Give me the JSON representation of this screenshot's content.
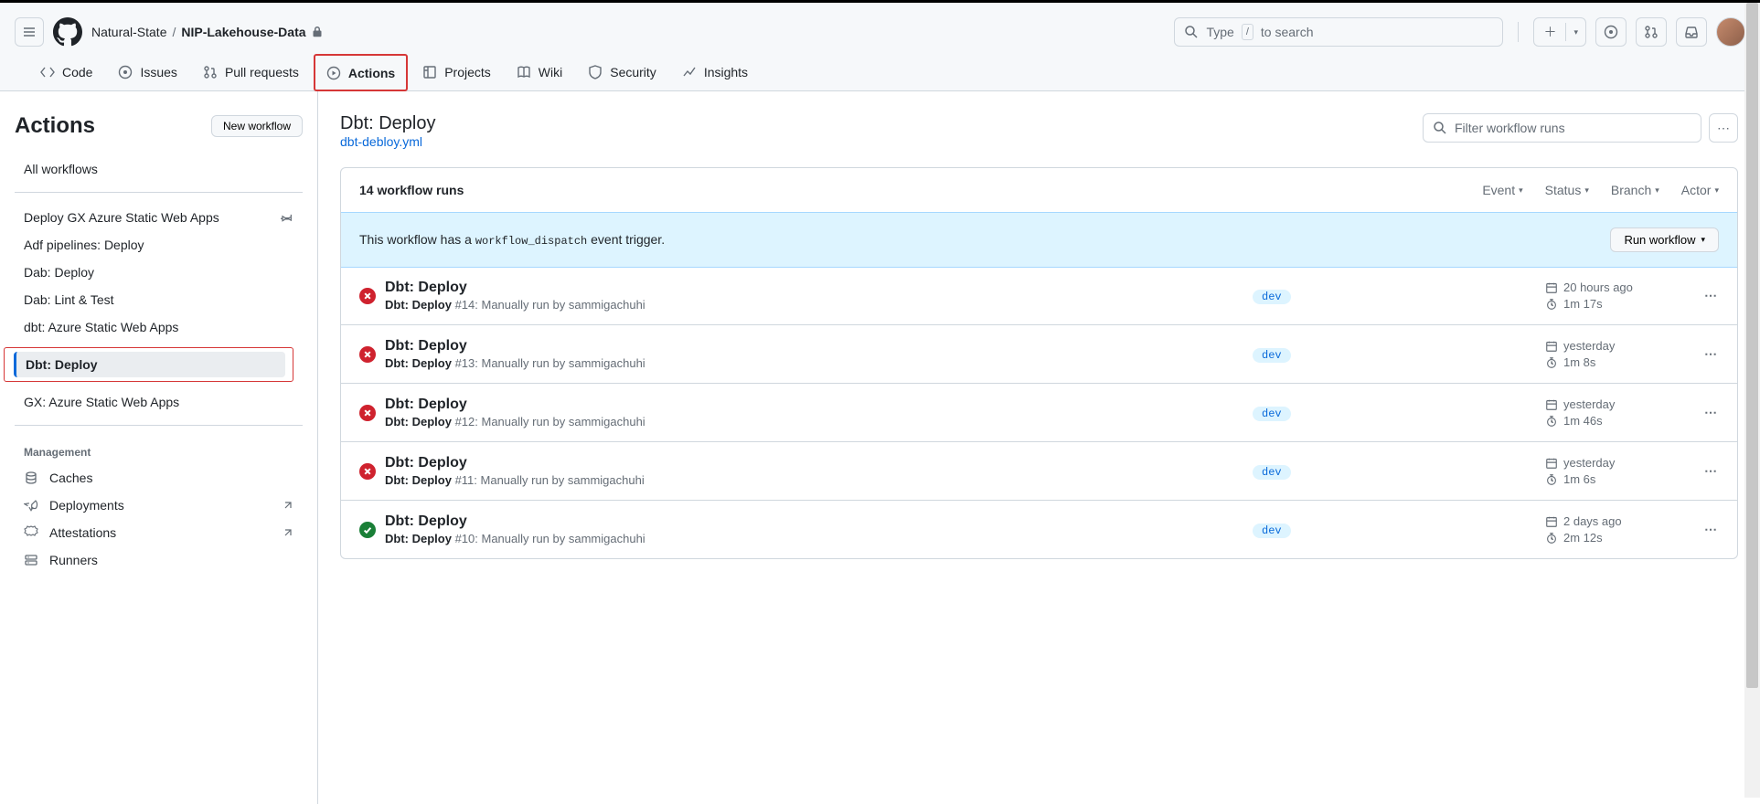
{
  "breadcrumb": {
    "owner": "Natural-State",
    "repo": "NIP-Lakehouse-Data"
  },
  "search": {
    "placeholder_prefix": "Type ",
    "placeholder_suffix": " to search",
    "kbd": "/"
  },
  "tabs": {
    "code": "Code",
    "issues": "Issues",
    "pulls": "Pull requests",
    "actions": "Actions",
    "projects": "Projects",
    "wiki": "Wiki",
    "security": "Security",
    "insights": "Insights"
  },
  "sidebar": {
    "title": "Actions",
    "new_workflow": "New workflow",
    "all_workflows": "All workflows",
    "workflows": [
      "Deploy GX Azure Static Web Apps",
      "Adf pipelines: Deploy",
      "Dab: Deploy",
      "Dab: Lint & Test",
      "dbt: Azure Static Web Apps",
      "Dbt: Deploy",
      "GX: Azure Static Web Apps"
    ],
    "management_label": "Management",
    "management": {
      "caches": "Caches",
      "deployments": "Deployments",
      "attestations": "Attestations",
      "runners": "Runners"
    }
  },
  "main": {
    "title": "Dbt: Deploy",
    "file": "dbt-debloy.yml",
    "filter_placeholder": "Filter workflow runs",
    "count_text": "14 workflow runs",
    "filters": {
      "event": "Event",
      "status": "Status",
      "branch": "Branch",
      "actor": "Actor"
    },
    "dispatch_prefix": "This workflow has a ",
    "dispatch_code": "workflow_dispatch",
    "dispatch_suffix": " event trigger.",
    "run_workflow": "Run workflow"
  },
  "runs": [
    {
      "status": "fail",
      "title": "Dbt: Deploy",
      "sub_name": "Dbt: Deploy",
      "num": "#14",
      "suffix": ": Manually run by sammigachuhi",
      "branch": "dev",
      "when": "20 hours ago",
      "dur": "1m 17s"
    },
    {
      "status": "fail",
      "title": "Dbt: Deploy",
      "sub_name": "Dbt: Deploy",
      "num": "#13",
      "suffix": ": Manually run by sammigachuhi",
      "branch": "dev",
      "when": "yesterday",
      "dur": "1m 8s"
    },
    {
      "status": "fail",
      "title": "Dbt: Deploy",
      "sub_name": "Dbt: Deploy",
      "num": "#12",
      "suffix": ": Manually run by sammigachuhi",
      "branch": "dev",
      "when": "yesterday",
      "dur": "1m 46s"
    },
    {
      "status": "fail",
      "title": "Dbt: Deploy",
      "sub_name": "Dbt: Deploy",
      "num": "#11",
      "suffix": ": Manually run by sammigachuhi",
      "branch": "dev",
      "when": "yesterday",
      "dur": "1m 6s"
    },
    {
      "status": "success",
      "title": "Dbt: Deploy",
      "sub_name": "Dbt: Deploy",
      "num": "#10",
      "suffix": ": Manually run by sammigachuhi",
      "branch": "dev",
      "when": "2 days ago",
      "dur": "2m 12s"
    }
  ]
}
